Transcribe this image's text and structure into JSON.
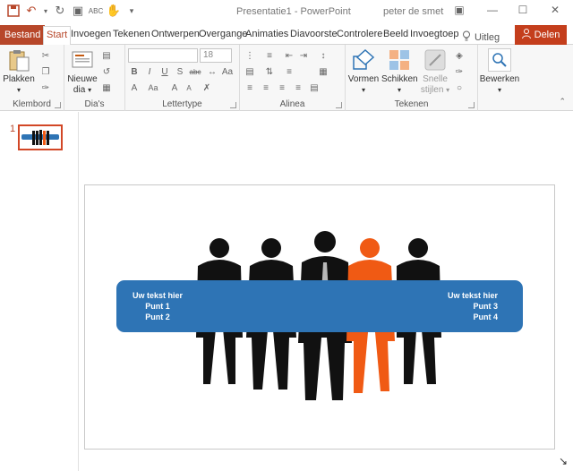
{
  "window": {
    "title": "Presentatie1  -  PowerPoint",
    "user": "peter de smet"
  },
  "tabs": [
    {
      "label": "Bestand"
    },
    {
      "label": "Start"
    },
    {
      "label": "Invoegen"
    },
    {
      "label": "Tekenen"
    },
    {
      "label": "Ontwerpen"
    },
    {
      "label": "Overgange"
    },
    {
      "label": "Animaties"
    },
    {
      "label": "Diavoorste"
    },
    {
      "label": "Controlere"
    },
    {
      "label": "Beeld"
    },
    {
      "label": "Invoegtoep"
    }
  ],
  "tell_me": "Uitleg",
  "share": "Delen",
  "ribbon": {
    "paste": "Plakken",
    "new_slide_1": "Nieuwe",
    "new_slide_2": "dia",
    "font_size": "18",
    "arrange": "Vormen",
    "arrange2": "Schikken",
    "quick_styles_1": "Snelle",
    "quick_styles_2": "stijlen",
    "edit": "Bewerken",
    "groups": {
      "clipboard": "Klembord",
      "slides": "Dia's",
      "font": "Lettertype",
      "paragraph": "Alinea",
      "drawing": "Tekenen"
    }
  },
  "slides_pane": {
    "number": "1"
  },
  "slide": {
    "left_heading": "Uw tekst hier",
    "left_points": [
      "Punt 1",
      "Punt 2"
    ],
    "right_heading": "Uw tekst hier",
    "right_points": [
      "Punt 3",
      "Punt 4"
    ]
  },
  "colors": {
    "accent": "#b7472a",
    "share": "#c43e1c",
    "banner": "#2e74b5",
    "figure_highlight": "#f05a14",
    "figure": "#111111"
  }
}
